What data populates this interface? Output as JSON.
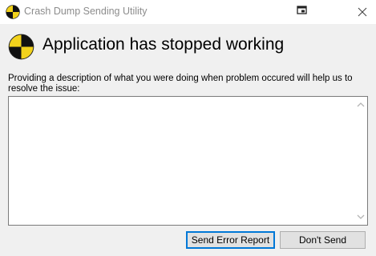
{
  "window": {
    "title": "Crash Dump Sending Utility",
    "pin_icon": "pin-window-icon",
    "close_icon": "close-icon",
    "app_icon": "crash-utility-icon"
  },
  "header": {
    "title": "Application has stopped working",
    "icon": "crash-utility-icon"
  },
  "prompt": {
    "text": "Providing a description of what you were doing when problem occured will help us to resolve the issue:"
  },
  "description": {
    "value": "",
    "placeholder": ""
  },
  "buttons": {
    "send_label": "Send Error Report",
    "dont_send_label": "Don't Send"
  },
  "colors": {
    "accent": "#0078d7",
    "icon_yellow": "#f2d21c",
    "icon_black": "#111111",
    "dialog_background": "#f0f0f0"
  }
}
